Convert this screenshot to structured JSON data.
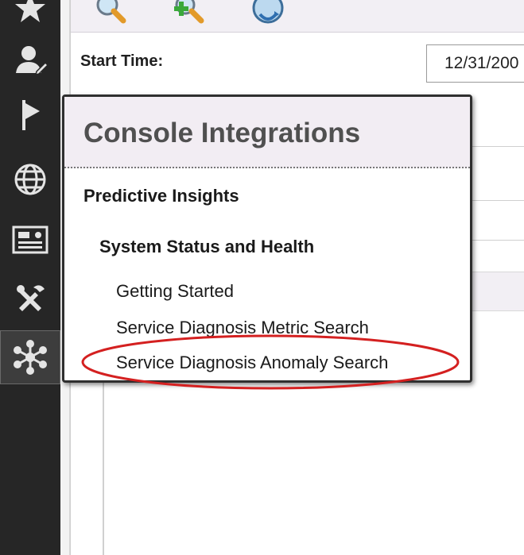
{
  "sidebar": {
    "items": [
      {
        "icon": "star-icon",
        "active": false
      },
      {
        "icon": "user-edit-icon",
        "active": false
      },
      {
        "icon": "flag-icon",
        "active": false
      },
      {
        "icon": "globe-icon",
        "active": false
      },
      {
        "icon": "dashboard-panel-icon",
        "active": false
      },
      {
        "icon": "tools-icon",
        "active": false
      },
      {
        "icon": "integrations-hub-icon",
        "active": true
      }
    ]
  },
  "toolbar": {
    "icons": [
      "search-icon",
      "add-search-icon",
      "refresh-icon"
    ]
  },
  "form": {
    "start_time_label": "Start Time:",
    "start_time_value": "12/31/200"
  },
  "popup": {
    "title": "Console Integrations",
    "section": "Predictive Insights",
    "subsection": "System Status and Health",
    "items": [
      "Getting Started",
      "Service Diagnosis Metric Search",
      "Service Diagnosis Anomaly Search"
    ],
    "highlighted_item": "Service Diagnosis Anomaly Search"
  },
  "colors": {
    "nav_bg": "#262626",
    "popup_header_bg": "#f2edf3",
    "highlight_oval": "#d42020"
  }
}
